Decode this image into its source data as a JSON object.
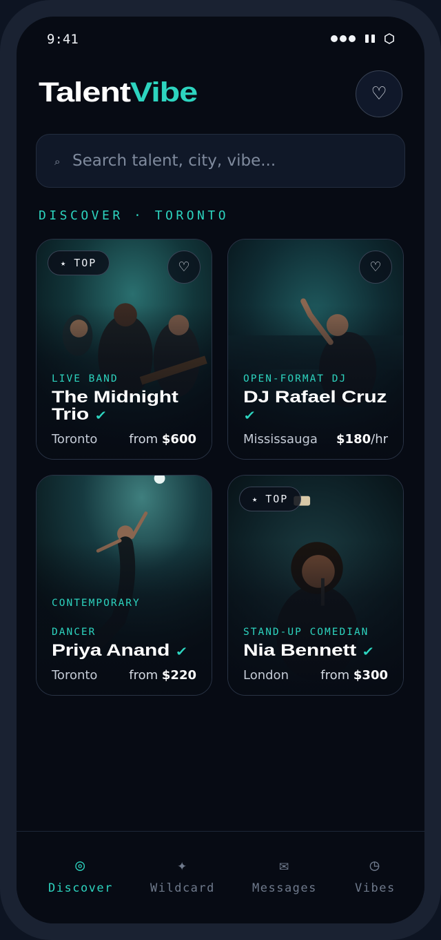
{
  "status": {
    "time": "9:41"
  },
  "header": {
    "brand_part1": "Talent",
    "brand_part2": "Vibe",
    "fav_icon": "heart-outline-icon"
  },
  "search": {
    "placeholder": "Search talent, city, vibe...",
    "value": ""
  },
  "section": {
    "title": "DISCOVER · TORONTO"
  },
  "cards": [
    {
      "badge": "TOP",
      "category_lines": [
        "LIVE BAND"
      ],
      "name": "The Midnight Trio",
      "verified": true,
      "city": "Toronto",
      "price_prefix": "from ",
      "price": "$600",
      "price_suffix": ""
    },
    {
      "badge": "",
      "category_lines": [
        "OPEN-FORMAT DJ"
      ],
      "name": "DJ Rafael Cruz",
      "verified": true,
      "city": "Mississauga",
      "price_prefix": "",
      "price": "$180",
      "price_suffix": "/hr"
    },
    {
      "badge": "",
      "category_lines": [
        "CONTEMPORARY",
        "",
        "DANCER"
      ],
      "name": "Priya Anand",
      "verified": true,
      "city": "Toronto",
      "price_prefix": "from ",
      "price": "$220",
      "price_suffix": ""
    },
    {
      "badge": "TOP",
      "category_lines": [
        "STAND-UP COMEDIAN"
      ],
      "name": "Nia Bennett",
      "verified": true,
      "city": "London",
      "price_prefix": "from ",
      "price": "$300",
      "price_suffix": ""
    }
  ],
  "tabs": [
    {
      "label": "Discover",
      "icon": "target-icon",
      "active": true
    },
    {
      "label": "Wildcard",
      "icon": "sparkle-icon",
      "active": false
    },
    {
      "label": "Messages",
      "icon": "envelope-icon",
      "active": false
    },
    {
      "label": "Vibes",
      "icon": "clock-icon",
      "active": false
    }
  ],
  "colors": {
    "accent": "#2dd4bf",
    "background": "#070b14",
    "card_border": "#2a3446"
  }
}
